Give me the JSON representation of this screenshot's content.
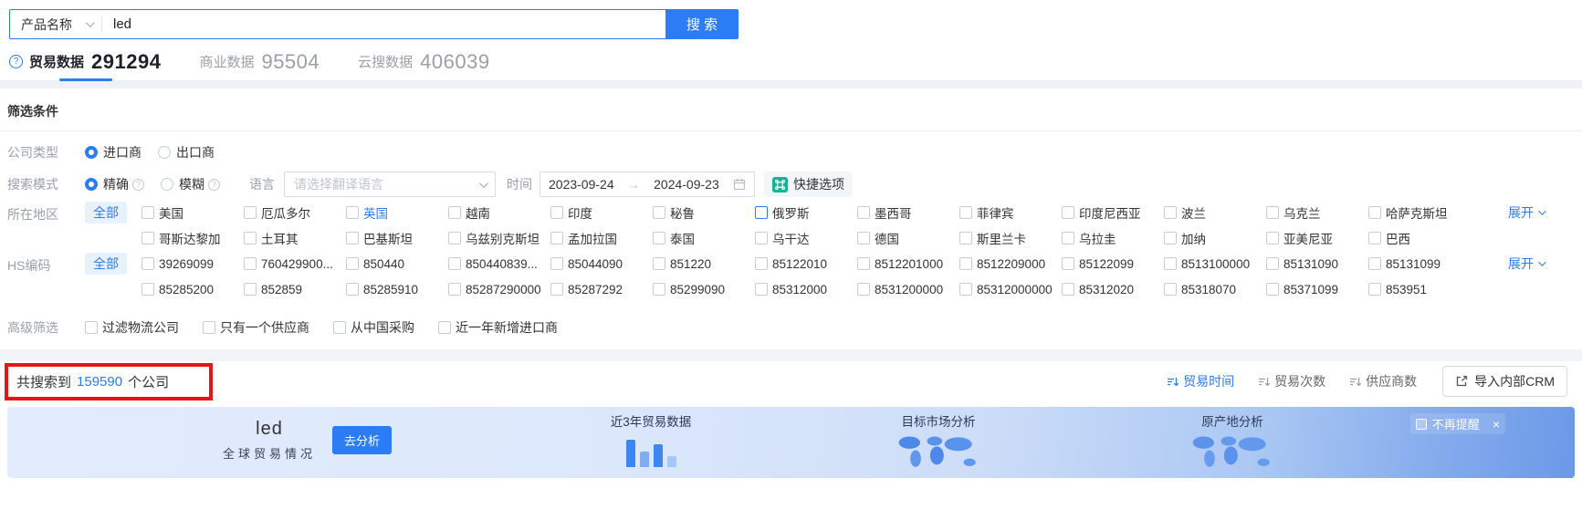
{
  "colors": {
    "primary": "#2b7cf5",
    "annotation_red": "#e51616",
    "quick_icon_green": "#17b394",
    "count_blue": "#2b7cf5"
  },
  "search": {
    "category_label": "产品名称",
    "query_value": "led",
    "button_label": "搜 索"
  },
  "tabs": [
    {
      "label": "贸易数据",
      "count": "291294",
      "active": true
    },
    {
      "label": "商业数据",
      "count": "95504",
      "active": false
    },
    {
      "label": "云搜数据",
      "count": "406039",
      "active": false
    }
  ],
  "filters": {
    "title": "筛选条件",
    "company_type_label": "公司类型",
    "company_type_options": [
      {
        "label": "进口商",
        "selected": true
      },
      {
        "label": "出口商",
        "selected": false
      }
    ],
    "search_mode_label": "搜索模式",
    "search_mode_options": [
      {
        "label": "精确",
        "selected": true
      },
      {
        "label": "模糊",
        "selected": false
      }
    ],
    "language_label": "语言",
    "language_placeholder": "请选择翻译语言",
    "time_label": "时间",
    "time_start": "2023-09-24",
    "time_arrow": "→",
    "time_end": "2024-09-23",
    "quick_option_label": "快捷选项",
    "region_label": "所在地区",
    "all_label": "全部",
    "expand_label": "展开",
    "region_row1": [
      {
        "label": "美国"
      },
      {
        "label": "厄瓜多尔"
      },
      {
        "label": "英国",
        "text_blue": true
      },
      {
        "label": "越南"
      },
      {
        "label": "印度"
      },
      {
        "label": "秘鲁"
      },
      {
        "label": "俄罗斯",
        "box_blue": true
      },
      {
        "label": "墨西哥"
      },
      {
        "label": "菲律宾"
      },
      {
        "label": "印度尼西亚"
      },
      {
        "label": "波兰"
      },
      {
        "label": "乌克兰"
      },
      {
        "label": "哈萨克斯坦"
      }
    ],
    "region_row2": [
      {
        "label": "哥斯达黎加"
      },
      {
        "label": "土耳其"
      },
      {
        "label": "巴基斯坦"
      },
      {
        "label": "乌兹别克斯坦"
      },
      {
        "label": "孟加拉国"
      },
      {
        "label": "泰国"
      },
      {
        "label": "乌干达"
      },
      {
        "label": "德国"
      },
      {
        "label": "斯里兰卡"
      },
      {
        "label": "乌拉圭"
      },
      {
        "label": "加纳"
      },
      {
        "label": "亚美尼亚"
      },
      {
        "label": "巴西"
      }
    ],
    "hs_label": "HS编码",
    "hs_row1": [
      {
        "label": "39269099"
      },
      {
        "label": "760429900..."
      },
      {
        "label": "850440"
      },
      {
        "label": "850440839..."
      },
      {
        "label": "85044090"
      },
      {
        "label": "851220"
      },
      {
        "label": "85122010"
      },
      {
        "label": "8512201000"
      },
      {
        "label": "8512209000"
      },
      {
        "label": "85122099"
      },
      {
        "label": "8513100000"
      },
      {
        "label": "85131090"
      },
      {
        "label": "85131099"
      }
    ],
    "hs_row2": [
      {
        "label": "85285200"
      },
      {
        "label": "852859"
      },
      {
        "label": "85285910"
      },
      {
        "label": "85287290000"
      },
      {
        "label": "85287292"
      },
      {
        "label": "85299090"
      },
      {
        "label": "85312000"
      },
      {
        "label": "8531200000"
      },
      {
        "label": "85312000000"
      },
      {
        "label": "85312020"
      },
      {
        "label": "85318070"
      },
      {
        "label": "85371099"
      },
      {
        "label": "853951"
      }
    ],
    "advanced_label": "高级筛选",
    "advanced_options": [
      {
        "label": "过滤物流公司"
      },
      {
        "label": "只有一个供应商"
      },
      {
        "label": "从中国采购"
      },
      {
        "label": "近一年新增进口商"
      }
    ]
  },
  "results": {
    "prefix": "共搜索到",
    "count": "159590",
    "suffix": "个公司",
    "sorts": [
      {
        "label": "贸易时间",
        "active": true
      },
      {
        "label": "贸易次数",
        "active": false
      },
      {
        "label": "供应商数",
        "active": false
      }
    ],
    "import_crm_label": "导入内部CRM"
  },
  "banner": {
    "keyword": "led",
    "subtitle": "全球贸易情况",
    "analyze_label": "去分析",
    "section_trade": "近3年贸易数据",
    "section_market": "目标市场分析",
    "section_origin": "原产地分析",
    "dismiss_label": "不再提醒",
    "close_label": "×"
  }
}
